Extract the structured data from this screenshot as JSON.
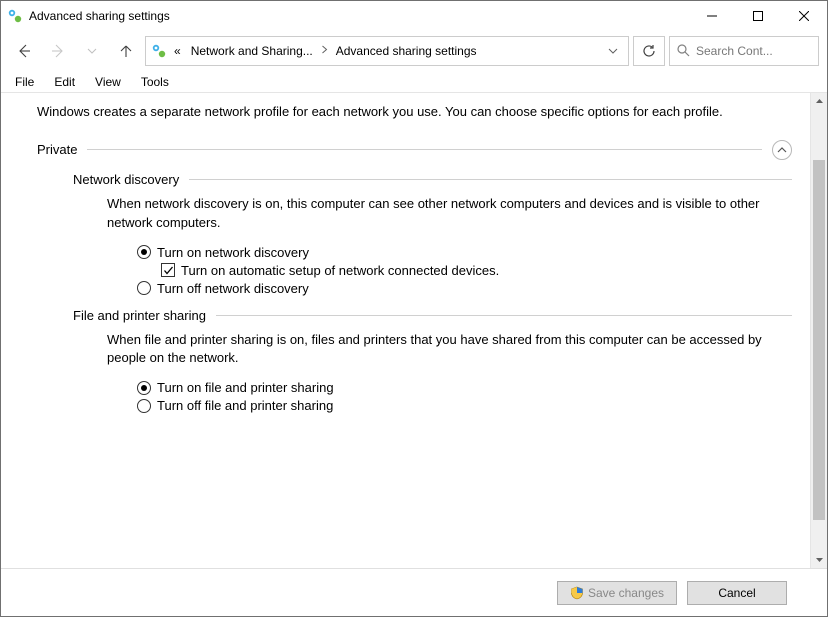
{
  "window": {
    "title": "Advanced sharing settings"
  },
  "breadcrumbs": {
    "trunc": "«",
    "item1": "Network and Sharing...",
    "item2": "Advanced sharing settings"
  },
  "search": {
    "placeholder": "Search Cont..."
  },
  "menu": {
    "file": "File",
    "edit": "Edit",
    "view": "View",
    "tools": "Tools"
  },
  "intro": "Windows creates a separate network profile for each network you use. You can choose specific options for each profile.",
  "private": {
    "label": "Private",
    "network_discovery": {
      "label": "Network discovery",
      "desc": "When network discovery is on, this computer can see other network computers and devices and is visible to other network computers.",
      "on": "Turn on network discovery",
      "auto": "Turn on automatic setup of network connected devices.",
      "off": "Turn off network discovery"
    },
    "file_printer": {
      "label": "File and printer sharing",
      "desc": "When file and printer sharing is on, files and printers that you have shared from this computer can be accessed by people on the network.",
      "on": "Turn on file and printer sharing",
      "off": "Turn off file and printer sharing"
    }
  },
  "footer": {
    "save": "Save changes",
    "cancel": "Cancel"
  }
}
